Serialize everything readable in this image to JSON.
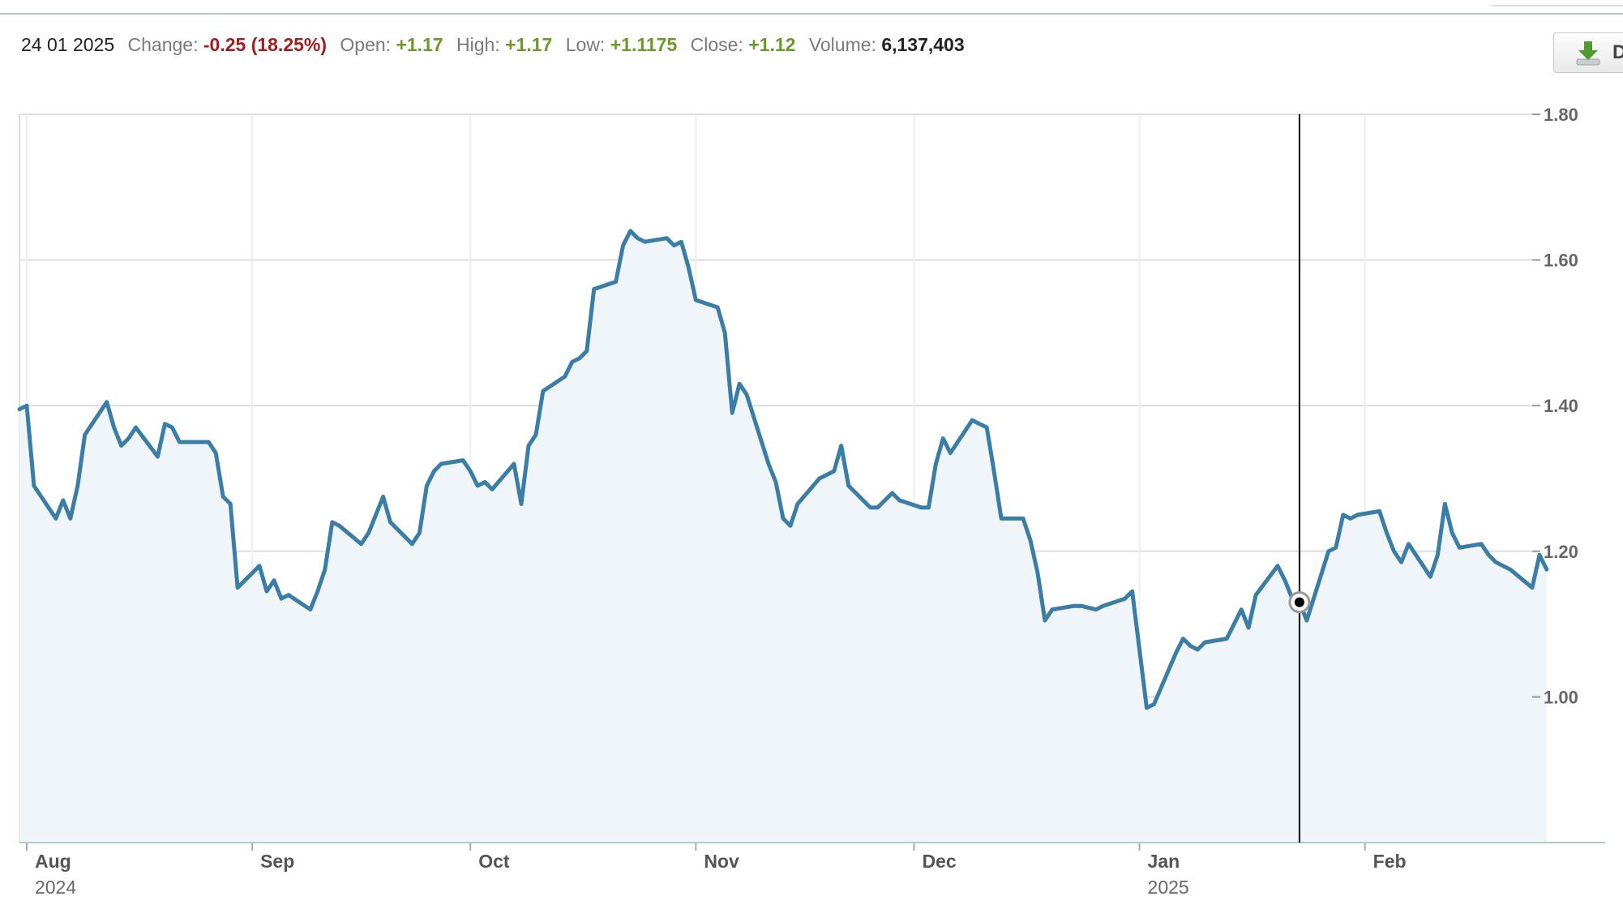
{
  "info_bar": {
    "date": "24 01 2025",
    "change_label": "Change:",
    "change_value": "-0.25 (18.25%)",
    "open_label": "Open:",
    "open_value": "+1.17",
    "high_label": "High:",
    "high_value": "+1.17",
    "low_label": "Low:",
    "low_value": "+1.1175",
    "close_label": "Close:",
    "close_value": "+1.12",
    "volume_label": "Volume:",
    "volume_value": "6,137,403"
  },
  "download_button": {
    "label": "D",
    "icon": "download-arrow-icon"
  },
  "colors": {
    "line": "#3a7ea8",
    "fill": "#f0f5f9",
    "negative": "#a01e1e",
    "positive": "#6a9a2a",
    "grid": "#dddddd",
    "crosshair": "#000000"
  },
  "chart_data": {
    "type": "area",
    "title": "",
    "xlabel": "",
    "ylabel": "",
    "ylim": [
      0.8,
      1.8
    ],
    "yticks": [
      "1.80",
      "1.60",
      "1.40",
      "1.20",
      "1.00"
    ],
    "ytick_values": [
      1.8,
      1.6,
      1.4,
      1.2,
      1.0
    ],
    "xlim": [
      "2024-07-31",
      "2025-02-24"
    ],
    "xticks": [
      {
        "label": "Aug",
        "date": "2024-08-01",
        "year": "2024"
      },
      {
        "label": "Sep",
        "date": "2024-09-01"
      },
      {
        "label": "Oct",
        "date": "2024-10-01"
      },
      {
        "label": "Nov",
        "date": "2024-11-01"
      },
      {
        "label": "Dec",
        "date": "2024-12-01"
      },
      {
        "label": "Jan",
        "date": "2025-01-01",
        "year": "2025"
      },
      {
        "label": "Feb",
        "date": "2025-02-01"
      }
    ],
    "grid": true,
    "legend": "none",
    "crosshair": {
      "date": "2025-01-23",
      "value": 1.13
    },
    "series": [
      {
        "points": [
          [
            "2024-07-31",
            1.395
          ],
          [
            "2024-08-01",
            1.4
          ],
          [
            "2024-08-02",
            1.29
          ],
          [
            "2024-08-05",
            1.245
          ],
          [
            "2024-08-06",
            1.27
          ],
          [
            "2024-08-07",
            1.245
          ],
          [
            "2024-08-08",
            1.29
          ],
          [
            "2024-08-09",
            1.36
          ],
          [
            "2024-08-12",
            1.405
          ],
          [
            "2024-08-13",
            1.37
          ],
          [
            "2024-08-14",
            1.345
          ],
          [
            "2024-08-15",
            1.355
          ],
          [
            "2024-08-16",
            1.37
          ],
          [
            "2024-08-19",
            1.33
          ],
          [
            "2024-08-20",
            1.375
          ],
          [
            "2024-08-21",
            1.37
          ],
          [
            "2024-08-22",
            1.35
          ],
          [
            "2024-08-23",
            1.35
          ],
          [
            "2024-08-26",
            1.35
          ],
          [
            "2024-08-27",
            1.335
          ],
          [
            "2024-08-28",
            1.275
          ],
          [
            "2024-08-29",
            1.265
          ],
          [
            "2024-08-30",
            1.15
          ],
          [
            "2024-09-02",
            1.18
          ],
          [
            "2024-09-03",
            1.145
          ],
          [
            "2024-09-04",
            1.16
          ],
          [
            "2024-09-05",
            1.135
          ],
          [
            "2024-09-06",
            1.14
          ],
          [
            "2024-09-09",
            1.12
          ],
          [
            "2024-09-10",
            1.145
          ],
          [
            "2024-09-11",
            1.175
          ],
          [
            "2024-09-12",
            1.24
          ],
          [
            "2024-09-13",
            1.235
          ],
          [
            "2024-09-16",
            1.21
          ],
          [
            "2024-09-17",
            1.225
          ],
          [
            "2024-09-18",
            1.25
          ],
          [
            "2024-09-19",
            1.275
          ],
          [
            "2024-09-20",
            1.24
          ],
          [
            "2024-09-23",
            1.21
          ],
          [
            "2024-09-24",
            1.225
          ],
          [
            "2024-09-25",
            1.29
          ],
          [
            "2024-09-26",
            1.31
          ],
          [
            "2024-09-27",
            1.32
          ],
          [
            "2024-09-30",
            1.325
          ],
          [
            "2024-10-01",
            1.31
          ],
          [
            "2024-10-02",
            1.29
          ],
          [
            "2024-10-03",
            1.295
          ],
          [
            "2024-10-04",
            1.285
          ],
          [
            "2024-10-07",
            1.32
          ],
          [
            "2024-10-08",
            1.265
          ],
          [
            "2024-10-09",
            1.345
          ],
          [
            "2024-10-10",
            1.36
          ],
          [
            "2024-10-11",
            1.42
          ],
          [
            "2024-10-14",
            1.44
          ],
          [
            "2024-10-15",
            1.46
          ],
          [
            "2024-10-16",
            1.465
          ],
          [
            "2024-10-17",
            1.475
          ],
          [
            "2024-10-18",
            1.56
          ],
          [
            "2024-10-21",
            1.57
          ],
          [
            "2024-10-22",
            1.62
          ],
          [
            "2024-10-23",
            1.64
          ],
          [
            "2024-10-24",
            1.63
          ],
          [
            "2024-10-25",
            1.625
          ],
          [
            "2024-10-28",
            1.63
          ],
          [
            "2024-10-29",
            1.62
          ],
          [
            "2024-10-30",
            1.625
          ],
          [
            "2024-10-31",
            1.59
          ],
          [
            "2024-11-01",
            1.545
          ],
          [
            "2024-11-04",
            1.535
          ],
          [
            "2024-11-05",
            1.5
          ],
          [
            "2024-11-06",
            1.39
          ],
          [
            "2024-11-07",
            1.43
          ],
          [
            "2024-11-08",
            1.415
          ],
          [
            "2024-11-11",
            1.32
          ],
          [
            "2024-11-12",
            1.295
          ],
          [
            "2024-11-13",
            1.245
          ],
          [
            "2024-11-14",
            1.235
          ],
          [
            "2024-11-15",
            1.265
          ],
          [
            "2024-11-18",
            1.3
          ],
          [
            "2024-11-19",
            1.305
          ],
          [
            "2024-11-20",
            1.31
          ],
          [
            "2024-11-21",
            1.345
          ],
          [
            "2024-11-22",
            1.29
          ],
          [
            "2024-11-25",
            1.26
          ],
          [
            "2024-11-26",
            1.26
          ],
          [
            "2024-11-27",
            1.27
          ],
          [
            "2024-11-28",
            1.28
          ],
          [
            "2024-11-29",
            1.27
          ],
          [
            "2024-12-02",
            1.26
          ],
          [
            "2024-12-03",
            1.26
          ],
          [
            "2024-12-04",
            1.32
          ],
          [
            "2024-12-05",
            1.355
          ],
          [
            "2024-12-06",
            1.335
          ],
          [
            "2024-12-09",
            1.38
          ],
          [
            "2024-12-10",
            1.375
          ],
          [
            "2024-12-11",
            1.37
          ],
          [
            "2024-12-12",
            1.31
          ],
          [
            "2024-12-13",
            1.245
          ],
          [
            "2024-12-16",
            1.245
          ],
          [
            "2024-12-17",
            1.215
          ],
          [
            "2024-12-18",
            1.17
          ],
          [
            "2024-12-19",
            1.105
          ],
          [
            "2024-12-20",
            1.12
          ],
          [
            "2024-12-23",
            1.125
          ],
          [
            "2024-12-24",
            1.125
          ],
          [
            "2024-12-26",
            1.12
          ],
          [
            "2024-12-27",
            1.125
          ],
          [
            "2024-12-30",
            1.135
          ],
          [
            "2024-12-31",
            1.145
          ],
          [
            "2025-01-02",
            0.985
          ],
          [
            "2025-01-03",
            0.99
          ],
          [
            "2025-01-06",
            1.06
          ],
          [
            "2025-01-07",
            1.08
          ],
          [
            "2025-01-08",
            1.07
          ],
          [
            "2025-01-09",
            1.065
          ],
          [
            "2025-01-10",
            1.075
          ],
          [
            "2025-01-13",
            1.08
          ],
          [
            "2025-01-14",
            1.1
          ],
          [
            "2025-01-15",
            1.12
          ],
          [
            "2025-01-16",
            1.095
          ],
          [
            "2025-01-17",
            1.14
          ],
          [
            "2025-01-20",
            1.18
          ],
          [
            "2025-01-21",
            1.16
          ],
          [
            "2025-01-22",
            1.135
          ],
          [
            "2025-01-23",
            1.13
          ],
          [
            "2025-01-24",
            1.105
          ],
          [
            "2025-01-27",
            1.2
          ],
          [
            "2025-01-28",
            1.205
          ],
          [
            "2025-01-29",
            1.25
          ],
          [
            "2025-01-30",
            1.245
          ],
          [
            "2025-01-31",
            1.25
          ],
          [
            "2025-02-03",
            1.255
          ],
          [
            "2025-02-04",
            1.225
          ],
          [
            "2025-02-05",
            1.2
          ],
          [
            "2025-02-06",
            1.185
          ],
          [
            "2025-02-07",
            1.21
          ],
          [
            "2025-02-10",
            1.165
          ],
          [
            "2025-02-11",
            1.195
          ],
          [
            "2025-02-12",
            1.265
          ],
          [
            "2025-02-13",
            1.225
          ],
          [
            "2025-02-14",
            1.205
          ],
          [
            "2025-02-17",
            1.21
          ],
          [
            "2025-02-18",
            1.195
          ],
          [
            "2025-02-19",
            1.185
          ],
          [
            "2025-02-20",
            1.18
          ],
          [
            "2025-02-21",
            1.175
          ],
          [
            "2025-02-24",
            1.15
          ],
          [
            "2025-02-25",
            1.195
          ],
          [
            "2025-02-26",
            1.175
          ]
        ]
      }
    ]
  }
}
